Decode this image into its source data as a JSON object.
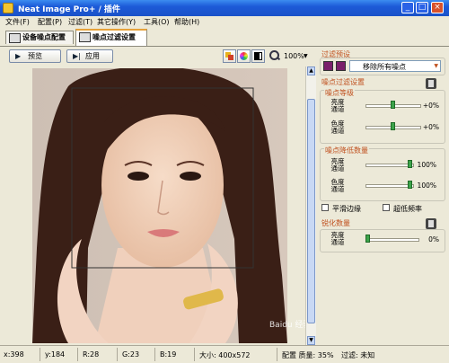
{
  "window": {
    "title": "Neat Image Pro+ / 插件"
  },
  "window_buttons": {
    "minimize": "_",
    "maximize": "□",
    "close": "×"
  },
  "menu": [
    "文件(F)",
    "配置(P)",
    "过滤(T)",
    "其它操作(Y)",
    "工具(O)",
    "帮助(H)"
  ],
  "tabs": [
    {
      "label": "设备噪点配置"
    },
    {
      "label": "噪点过滤设置"
    }
  ],
  "toolbar": {
    "preview_label": "预览",
    "apply_label": "应用",
    "zoom": "100%"
  },
  "panel": {
    "presets_header": "过滤预设",
    "preset_value": "移除所有噪点",
    "noise_filter_header": "噪点过滤设置",
    "noise_level_header": "噪点等级",
    "noise_level_luma": [
      "亮度",
      "通道"
    ],
    "noise_level_luma_value": "+0%",
    "noise_level_luma_pos": 0.5,
    "noise_level_chroma": [
      "色度",
      "通道"
    ],
    "noise_level_chroma_value": "+0%",
    "noise_level_chroma_pos": 0.5,
    "reduction_header": "噪点降低数量",
    "reduction_luma": [
      "亮度",
      "通道"
    ],
    "reduction_luma_value": "100%",
    "reduction_luma_pos": 1.0,
    "reduction_chroma": [
      "色度",
      "通道"
    ],
    "reduction_chroma_value": "100%",
    "reduction_chroma_pos": 1.0,
    "smooth_edges_label": "平滑边缘",
    "ultra_low_label": "超低频率",
    "sharpen_header": "锐化数量",
    "sharpen_luma": [
      "亮度",
      "通道"
    ],
    "sharpen_luma_value": "0%",
    "sharpen_luma_pos": 0.0
  },
  "status": {
    "x": "x:398",
    "y": "y:184",
    "r": "R:28",
    "g": "G:23",
    "b": "B:19",
    "size": "大小: 400x572",
    "profile": "配置 质量: 35%",
    "filter": "过滤: 未知"
  },
  "watermark": "Baidu 经验",
  "colors": {
    "accent": "#c0501e",
    "thumb": "#3ca34a",
    "titlebar": "#1c5ad8"
  }
}
